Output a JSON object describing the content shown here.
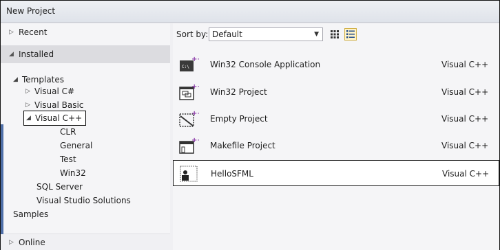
{
  "window": {
    "title": "New Project"
  },
  "left_pane": {
    "recent": "Recent",
    "installed": "Installed",
    "online": "Online",
    "tree": {
      "templates": "Templates",
      "visual_csharp": "Visual C#",
      "visual_basic": "Visual Basic",
      "visual_cpp": "Visual C++",
      "clr": "CLR",
      "general": "General",
      "test": "Test",
      "win32": "Win32",
      "sql_server": "SQL Server",
      "vs_solutions": "Visual Studio Solutions",
      "samples": "Samples"
    }
  },
  "toolbar": {
    "sort_label": "Sort by:",
    "sort_value": "Default"
  },
  "templates": [
    {
      "name": "Win32 Console Application",
      "language": "Visual C++",
      "icon": "console-app-icon"
    },
    {
      "name": "Win32 Project",
      "language": "Visual C++",
      "icon": "win32-project-icon"
    },
    {
      "name": "Empty Project",
      "language": "Visual C++",
      "icon": "empty-project-icon"
    },
    {
      "name": "Makefile Project",
      "language": "Visual C++",
      "icon": "makefile-project-icon"
    },
    {
      "name": "HelloSFML",
      "language": "Visual C++",
      "icon": "hellosfml-template-icon"
    }
  ],
  "colors": {
    "accent_plus": "#8b3aa8",
    "selection_bg": "#dcdce0"
  }
}
